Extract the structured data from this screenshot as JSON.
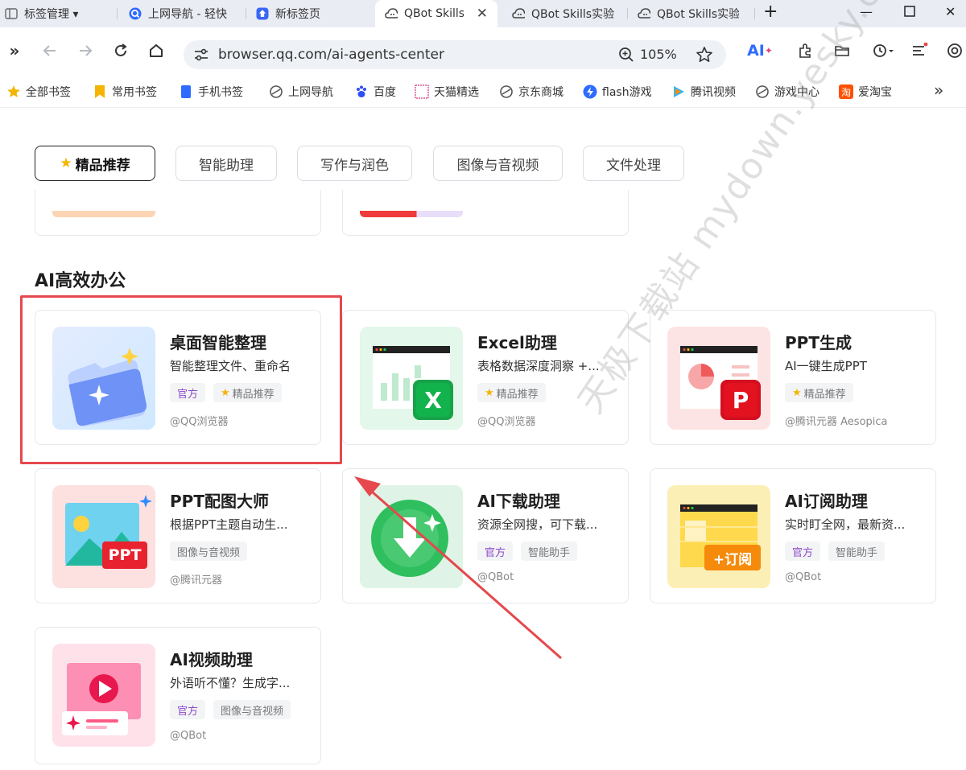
{
  "tabs": [
    {
      "label": "标签管理 ▾",
      "icon": "tab-manager-icon"
    },
    {
      "label": "上网导航 - 轻快",
      "icon": "q-search-icon"
    },
    {
      "label": "新标签页",
      "icon": "new-tab-icon"
    },
    {
      "label": "QBot Skills",
      "icon": "qbot-icon",
      "active": true
    },
    {
      "label": "QBot Skills实验",
      "icon": "qbot-icon"
    },
    {
      "label": "QBot Skills实验",
      "icon": "qbot-icon"
    }
  ],
  "address_bar": {
    "url": "browser.qq.com/ai-agents-center",
    "zoom": "105%"
  },
  "toolbar": {
    "ai_label": "AI"
  },
  "bookmarks": [
    {
      "label": "全部书签",
      "icon": "star-icon"
    },
    {
      "label": "常用书签",
      "icon": "bookmark-icon"
    },
    {
      "label": "手机书签",
      "icon": "phone-icon"
    },
    {
      "label": "上网导航",
      "icon": "navigation-icon"
    },
    {
      "label": "百度",
      "icon": "baidu-paw-icon"
    },
    {
      "label": "天猫精选",
      "icon": "tmall-icon"
    },
    {
      "label": "京东商城",
      "icon": "jd-icon"
    },
    {
      "label": "flash游戏",
      "icon": "flash-icon"
    },
    {
      "label": "腾讯视频",
      "icon": "tencent-video-icon"
    },
    {
      "label": "游戏中心",
      "icon": "game-center-icon"
    },
    {
      "label": "爱淘宝",
      "icon": "taobao-icon"
    }
  ],
  "categories": [
    "精品推荐",
    "智能助理",
    "写作与润色",
    "图像与音视频",
    "文件处理"
  ],
  "section_title": "AI高效办公",
  "cards": [
    {
      "title": "桌面智能整理",
      "desc": "智能整理文件、重命名",
      "tags": [
        {
          "text": "官方",
          "kind": "official"
        },
        {
          "text": "精品推荐",
          "kind": "featured"
        }
      ],
      "author": "@QQ浏览器",
      "thumb": "folder"
    },
    {
      "title": "Excel助理",
      "desc": "表格数据深度洞察 +...",
      "tags": [
        {
          "text": "精品推荐",
          "kind": "featured"
        }
      ],
      "author": "@QQ浏览器",
      "thumb": "excel"
    },
    {
      "title": "PPT生成",
      "desc": "AI一键生成PPT",
      "tags": [
        {
          "text": "精品推荐",
          "kind": "featured"
        }
      ],
      "author": "@腾讯元器 Aesopica",
      "thumb": "ppt"
    },
    {
      "title": "PPT配图大师",
      "desc": "根据PPT主题自动生...",
      "tags": [
        {
          "text": "图像与音视频",
          "kind": "plain"
        }
      ],
      "author": "@腾讯元器",
      "thumb": "pptimg"
    },
    {
      "title": "AI下载助理",
      "desc": "资源全网搜，可下载...",
      "tags": [
        {
          "text": "官方",
          "kind": "official"
        },
        {
          "text": "智能助手",
          "kind": "plain"
        }
      ],
      "author": "@QBot",
      "thumb": "download"
    },
    {
      "title": "AI订阅助理",
      "desc": "实时盯全网，最新资...",
      "tags": [
        {
          "text": "官方",
          "kind": "official"
        },
        {
          "text": "智能助手",
          "kind": "plain"
        }
      ],
      "author": "@QBot",
      "thumb": "subscribe"
    },
    {
      "title": "AI视频助理",
      "desc": "外语听不懂？生成字...",
      "tags": [
        {
          "text": "官方",
          "kind": "official"
        },
        {
          "text": "图像与音视频",
          "kind": "plain"
        }
      ],
      "author": "@QBot",
      "thumb": "video"
    }
  ],
  "thumb_text": {
    "excel": "X",
    "ppt": "P",
    "pptimg": "PPT",
    "subscribe": "+订阅"
  },
  "watermark": "天极下载站 mydown.yesky.com"
}
